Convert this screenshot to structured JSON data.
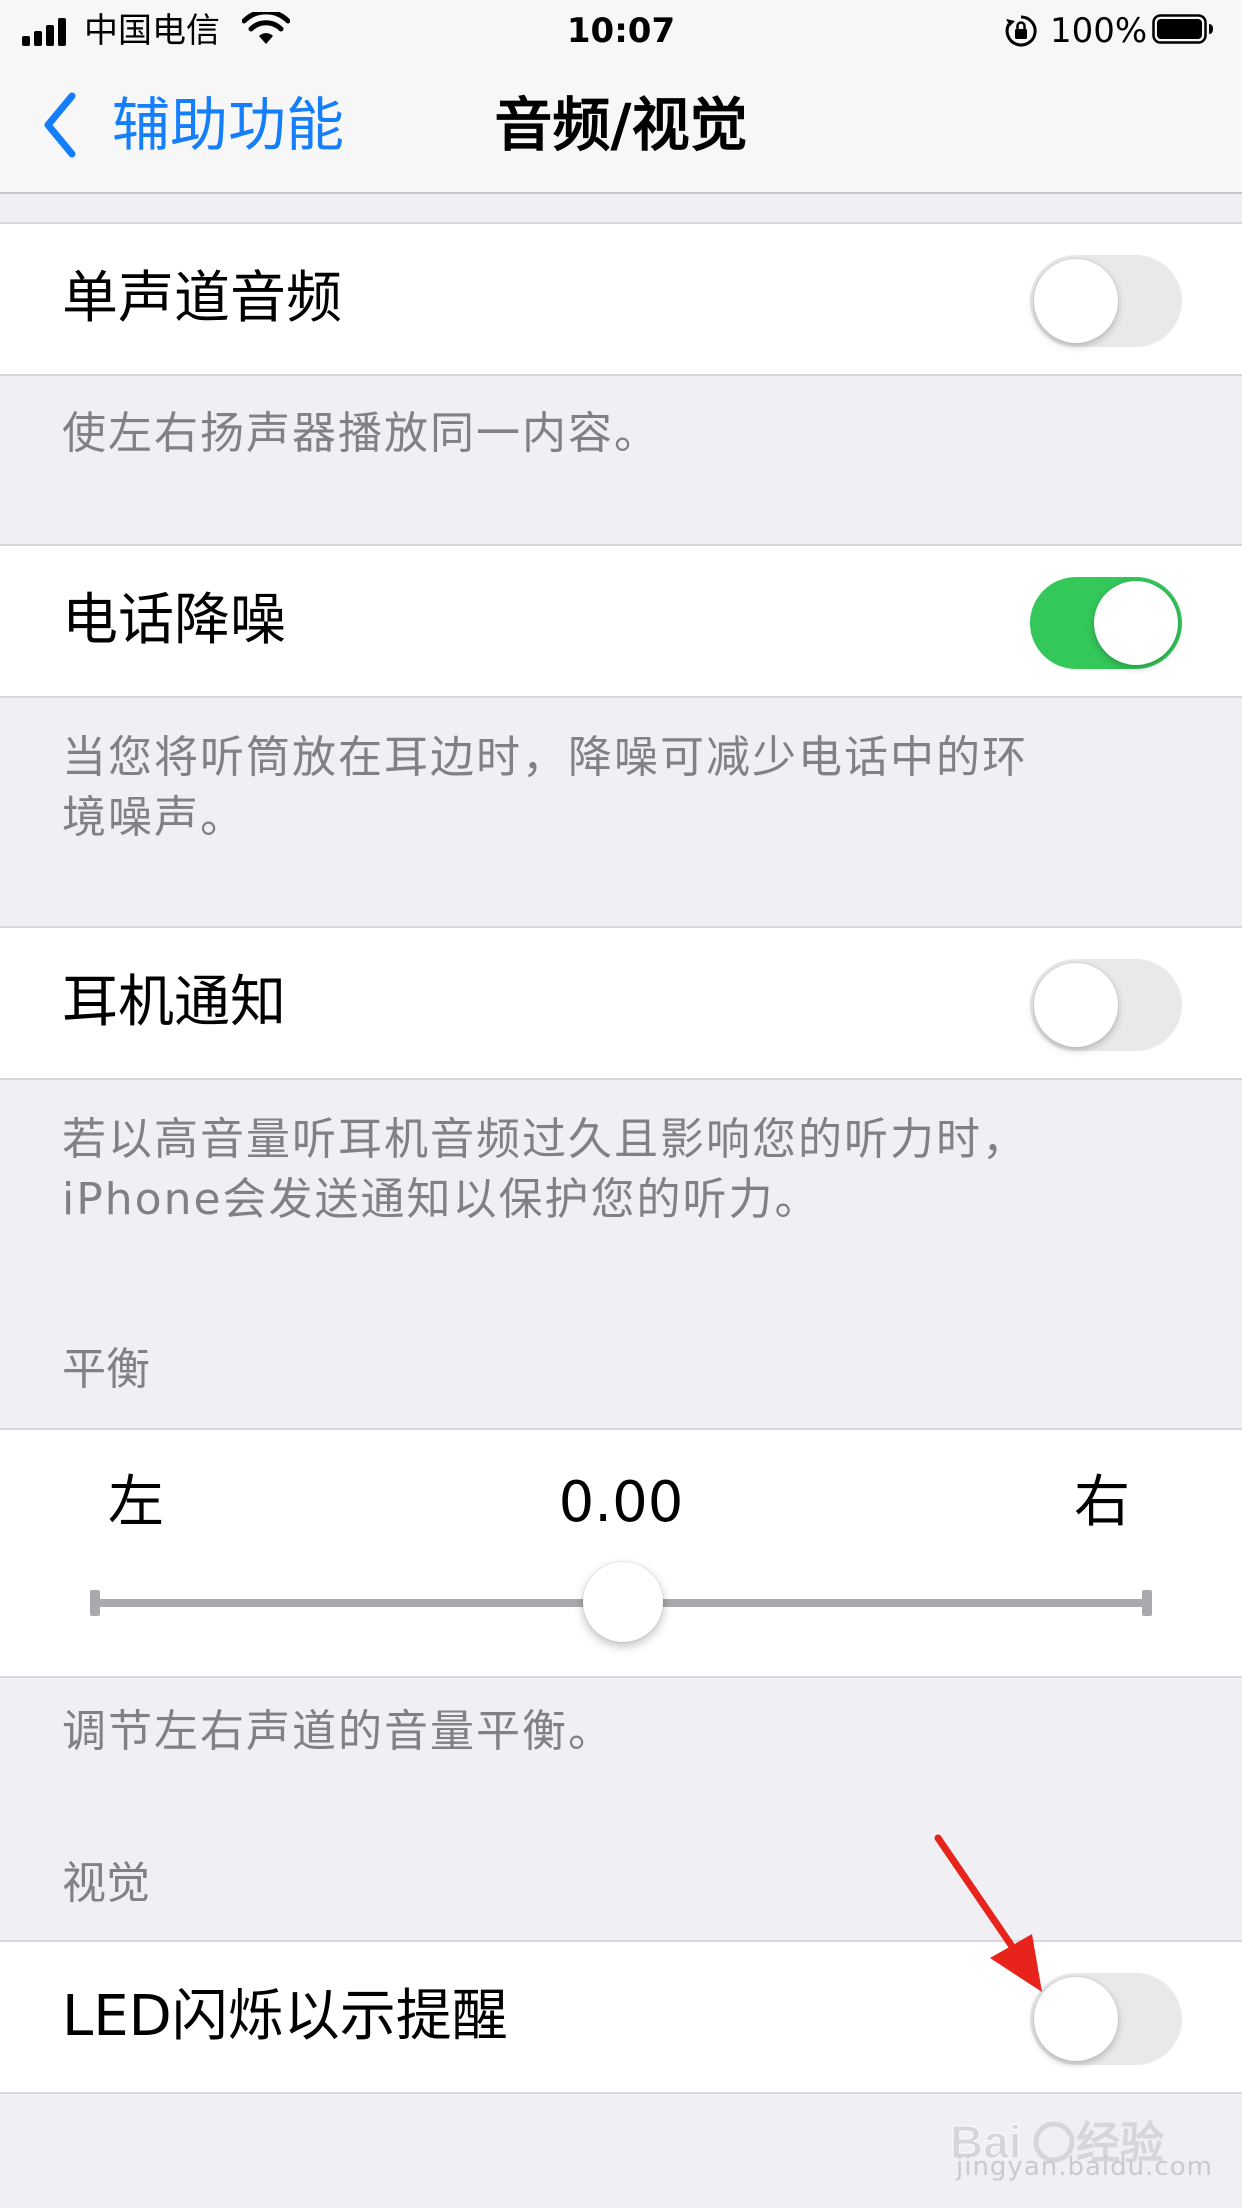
{
  "status_bar": {
    "carrier": "中国电信",
    "time": "10:07",
    "battery_percent": "100%",
    "signal_bars": 4,
    "icons": [
      "signal-icon",
      "wifi-icon",
      "orientation-lock-icon",
      "battery-icon"
    ]
  },
  "nav": {
    "back_label": "辅助功能",
    "title": "音频/视觉",
    "back_icon": "chevron-left-icon"
  },
  "settings": {
    "mono_audio": {
      "label": "单声道音频",
      "on": false,
      "footer": "使左右扬声器播放同一内容。"
    },
    "phone_noise": {
      "label": "电话降噪",
      "on": true,
      "footer_line1": "当您将听筒放在耳边时，降噪可减少电话中的环",
      "footer_line2": "境噪声。"
    },
    "headphone": {
      "label": "耳机通知",
      "on": false,
      "footer_line1": "若以高音量听耳机音频过久且影响您的听力时，",
      "footer_line2": "iPhone会发送通知以保护您的听力。"
    },
    "balance": {
      "header": "平衡",
      "left_label": "左",
      "right_label": "右",
      "value_text": "0.00",
      "value": 0.0,
      "range": [
        -1,
        1
      ],
      "footer": "调节左右声道的音量平衡。"
    },
    "visual": {
      "header": "视觉",
      "led_flash": {
        "label": "LED闪烁以示提醒",
        "on": false
      }
    }
  },
  "colors": {
    "accent": "#147efb",
    "toggle_on": "#34c759",
    "toggle_off": "#e9e9eb",
    "background": "#efeff4",
    "annotation": "#e8231c"
  },
  "watermark": {
    "text": "jingyan.baidu.com",
    "logo": "Baidu经验"
  }
}
